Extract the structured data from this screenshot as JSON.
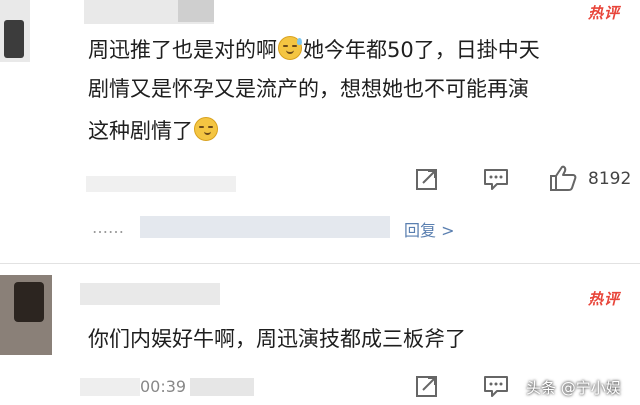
{
  "comment1": {
    "hot_badge": "热评",
    "text_line1_a": "周迅推了也是对的啊",
    "text_line1_b": "她今年都50了，日掛中天",
    "text_line2": "剧情又是怀孕又是流产的，想想她也不可能再演",
    "text_line3": "这种剧情了",
    "like_count": "8192",
    "reply_link": "回复 >"
  },
  "comment2": {
    "hot_badge": "热评",
    "text": "你们内娱好牛啊，周迅演技都成三板斧了",
    "timestamp_fragment": "00:39"
  },
  "watermark": {
    "text": "头条 @宁小娱"
  },
  "icons": {
    "share": "share-icon",
    "comment": "comment-icon",
    "like": "thumbs-up-icon",
    "emoji_sweat": "sweat-smile-emoji-icon",
    "emoji_smirk": "smirk-emoji-icon"
  },
  "colors": {
    "hot_badge": "#e8453a",
    "reply_link": "#5a7fb0"
  }
}
